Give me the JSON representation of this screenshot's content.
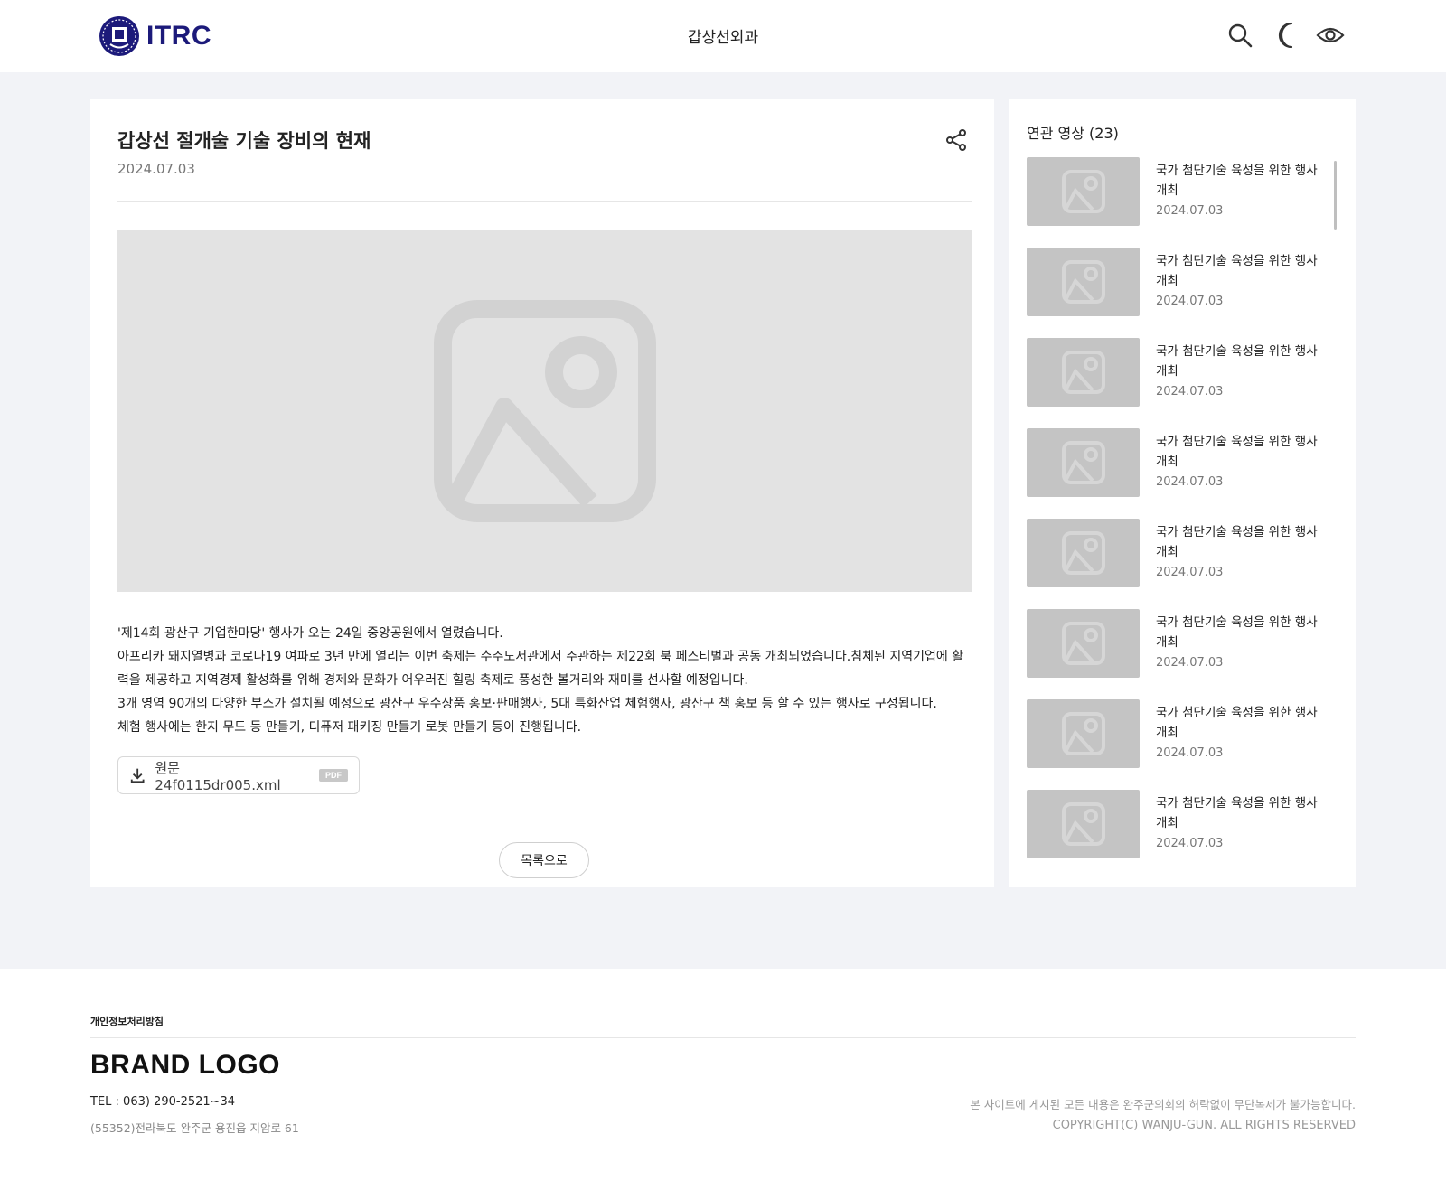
{
  "header": {
    "logo_text": "ITRC",
    "department": "갑상선외과",
    "icons": [
      "search-icon",
      "moon-icon",
      "eye-icon"
    ]
  },
  "post": {
    "title": "갑상선 절개술 기술 장비의 현재",
    "date": "2024.07.03",
    "body": [
      "'제14회 광산구 기업한마당' 행사가 오는 24일 중앙공원에서 열렸습니다.",
      "아프리카 돼지열병과 코로나19 여파로 3년 만에 열리는 이번 축제는 수주도서관에서 주관하는 제22회 북 페스티벌과 공동 개최되었습니다.침체된 지역기업에 활력을 제공하고 지역경제 활성화를 위해 경제와 문화가 어우러진 힐링 축제로 풍성한 볼거리와 재미를 선사할 예정입니다.",
      "3개 영역 90개의 다양한 부스가 설치될 예정으로 광산구 우수상품 홍보·판매행사, 5대 특화산업 체험행사, 광산구 책 홍보 등 할 수 있는 행사로 구성됩니다.",
      "체험 행사에는 한지 무드 등 만들기, 디퓨저 패키징 만들기 로봇 만들기 등이 진행됩니다."
    ],
    "attachment": {
      "name": "원문 24f0115dr005.xml",
      "badge": "PDF"
    },
    "list_button": "목록으로"
  },
  "sidebar": {
    "title": "연관 영상 (23)",
    "items": [
      {
        "title": "국가 첨단기술 육성을 위한 행사 개최",
        "date": "2024.07.03"
      },
      {
        "title": "국가 첨단기술 육성을 위한 행사 개최",
        "date": "2024.07.03"
      },
      {
        "title": "국가 첨단기술 육성을 위한 행사 개최",
        "date": "2024.07.03"
      },
      {
        "title": "국가 첨단기술 육성을 위한 행사 개최",
        "date": "2024.07.03"
      },
      {
        "title": "국가 첨단기술 육성을 위한 행사 개최",
        "date": "2024.07.03"
      },
      {
        "title": "국가 첨단기술 육성을 위한 행사 개최",
        "date": "2024.07.03"
      },
      {
        "title": "국가 첨단기술 육성을 위한 행사 개최",
        "date": "2024.07.03"
      },
      {
        "title": "국가 첨단기술 육성을 위한 행사 개최",
        "date": "2024.07.03"
      }
    ]
  },
  "footer": {
    "privacy": "개인정보처리방침",
    "brand": "BRAND LOGO",
    "tel": "TEL : 063) 290-2521~34",
    "address": "(55352)전라북도 완주군 용진읍 지암로 61",
    "notice": "본 사이트에 게시된 모든 내용은 완주군의회의 허락없이 무단복제가 불가능합니다.",
    "copyright": "COPYRIGHT(C) WANJU-GUN. ALL RIGHTS RESERVED"
  },
  "colors": {
    "brand": "#1c1a7a",
    "page_bg": "#f2f3f7",
    "placeholder": "#e3e3e3",
    "thumb": "#c4c4c4"
  }
}
